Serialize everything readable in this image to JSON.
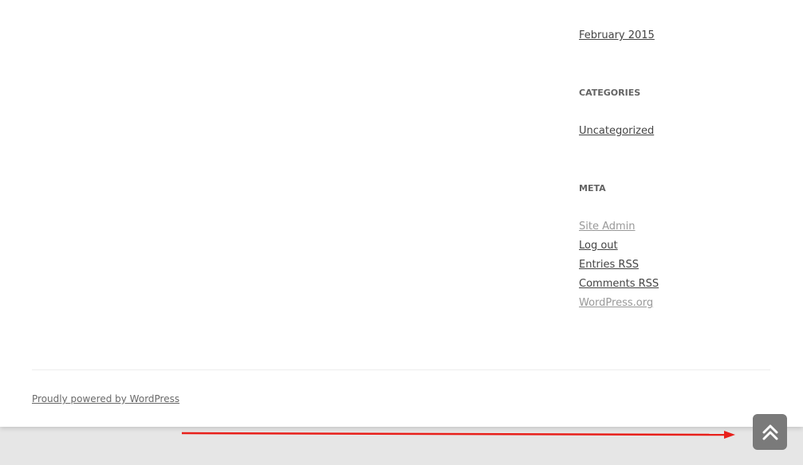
{
  "sidebar": {
    "archives": {
      "items": [
        "February 2015"
      ]
    },
    "categories": {
      "title": "CATEGORIES",
      "items": [
        "Uncategorized"
      ]
    },
    "meta": {
      "title": "META",
      "items": [
        "Site Admin",
        "Log out",
        "Entries RSS",
        "Comments RSS",
        "WordPress.org"
      ]
    }
  },
  "footer": {
    "credit": "Proudly powered by WordPress"
  },
  "colors": {
    "annotation_arrow": "#e8201b",
    "scroll_button": "#7a7a7a",
    "muted_link": "#999999"
  },
  "icons": {
    "scroll_top": "double-chevron-up-icon"
  }
}
